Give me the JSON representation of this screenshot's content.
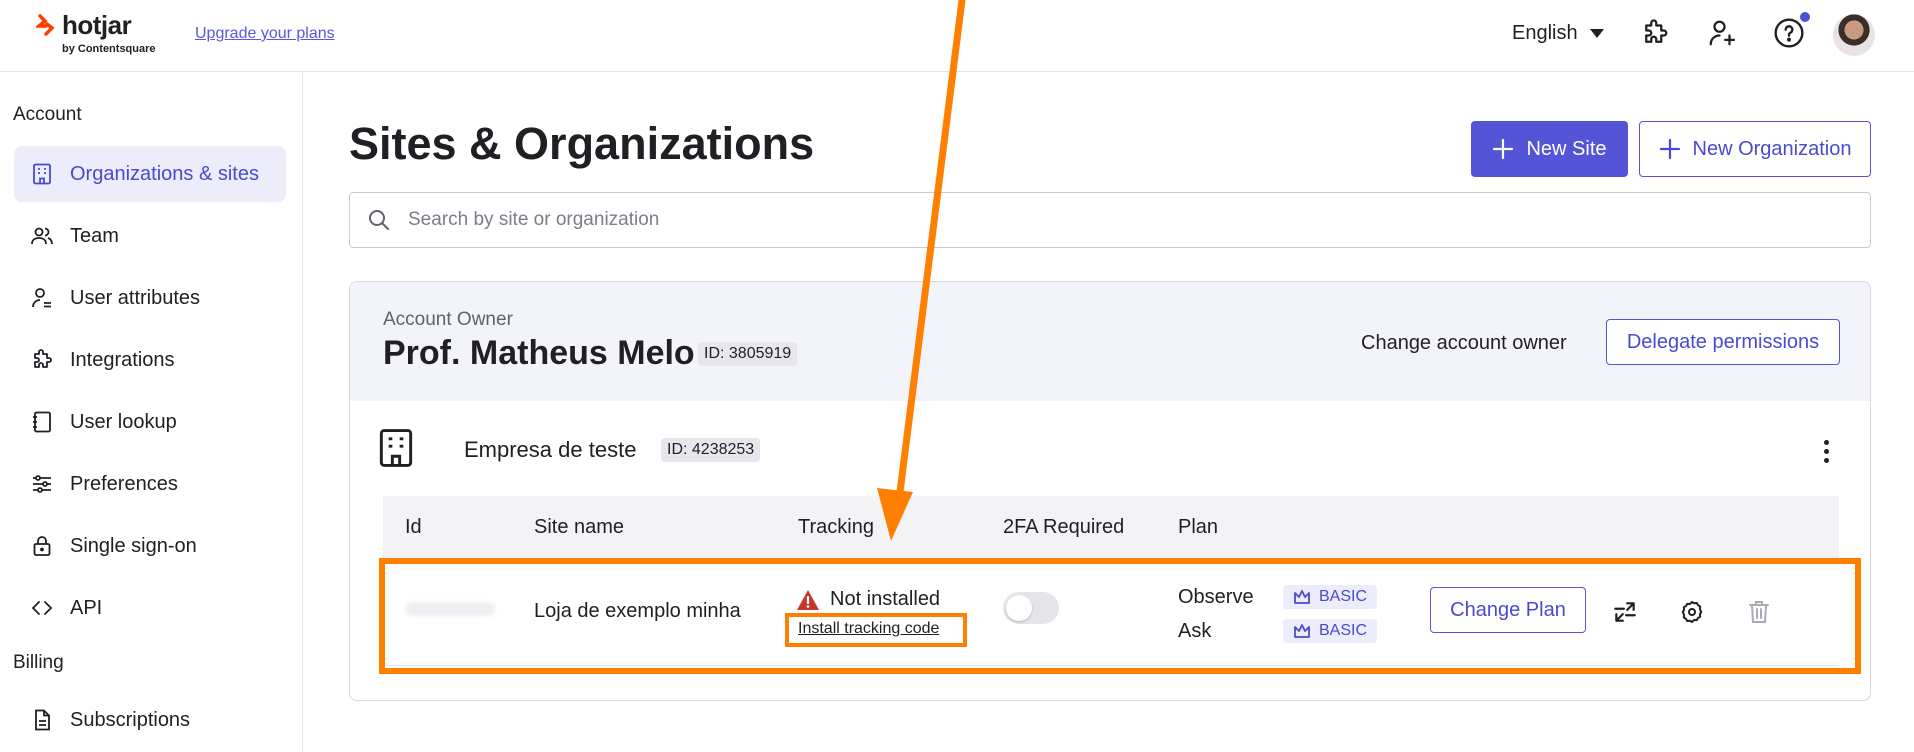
{
  "header": {
    "logo_text": "hotjar",
    "logo_sub": "by Contentsquare",
    "upgrade_link": "Upgrade your plans",
    "language": "English",
    "icons": [
      "puzzle-icon",
      "user-plus-icon",
      "help-icon"
    ],
    "accent": "#5454d6"
  },
  "sidebar": {
    "section_account": "Account",
    "section_billing": "Billing",
    "items": [
      {
        "label": "Organizations & sites",
        "icon": "building-icon",
        "active": true
      },
      {
        "label": "Team",
        "icon": "team-icon"
      },
      {
        "label": "User attributes",
        "icon": "user-attributes-icon"
      },
      {
        "label": "Integrations",
        "icon": "puzzle-icon"
      },
      {
        "label": "User lookup",
        "icon": "notebook-icon"
      },
      {
        "label": "Preferences",
        "icon": "sliders-icon"
      },
      {
        "label": "Single sign-on",
        "icon": "lock-icon"
      },
      {
        "label": "API",
        "icon": "code-icon"
      }
    ],
    "billing_items": [
      {
        "label": "Subscriptions",
        "icon": "document-icon"
      }
    ]
  },
  "main": {
    "title": "Sites & Organizations",
    "new_site": "New Site",
    "new_org": "New Organization",
    "search_placeholder": "Search by site or organization",
    "owner": {
      "label": "Account Owner",
      "name": "Prof. Matheus Melo",
      "id": "ID: 3805919",
      "change_owner": "Change account owner",
      "delegate": "Delegate permissions"
    },
    "org": {
      "name": "Empresa de teste",
      "id": "ID: 4238253"
    },
    "table": {
      "headers": [
        "Id",
        "Site name",
        "Tracking",
        "2FA Required",
        "Plan"
      ],
      "rows": [
        {
          "site_name": "Loja de exemplo minha",
          "tracking_status": "Not installed",
          "tracking_link": "Install tracking code",
          "twofa": false,
          "plans": [
            {
              "product": "Observe",
              "tier": "BASIC"
            },
            {
              "product": "Ask",
              "tier": "BASIC"
            }
          ],
          "change_plan": "Change Plan"
        }
      ]
    }
  },
  "annotation_color": "#ff7f00"
}
